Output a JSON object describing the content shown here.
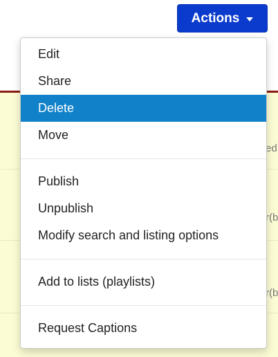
{
  "toolbar": {
    "actions_label": "Actions",
    "accent_color": "#0a3bcc"
  },
  "background_rows": {
    "fragments": [
      "ed",
      "r(b",
      "r(b"
    ]
  },
  "menu": {
    "groups": [
      {
        "items": [
          {
            "label": "Edit",
            "active": false
          },
          {
            "label": "Share",
            "active": false
          },
          {
            "label": "Delete",
            "active": true
          },
          {
            "label": "Move",
            "active": false
          }
        ]
      },
      {
        "items": [
          {
            "label": "Publish",
            "active": false
          },
          {
            "label": "Unpublish",
            "active": false
          },
          {
            "label": "Modify search and listing options",
            "active": false
          }
        ]
      },
      {
        "items": [
          {
            "label": "Add to lists (playlists)",
            "active": false
          }
        ]
      },
      {
        "items": [
          {
            "label": "Request Captions",
            "active": false
          }
        ]
      }
    ],
    "highlight_color": "#1182c9"
  }
}
